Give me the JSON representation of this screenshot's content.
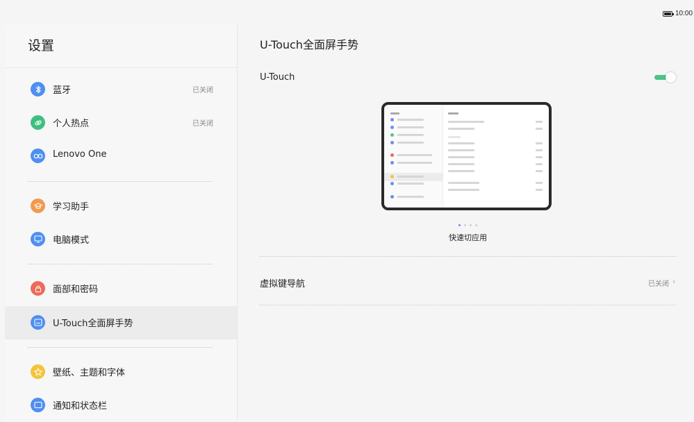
{
  "status_bar": {
    "time": "10:00",
    "battery_icon": "battery-full-icon"
  },
  "sidebar": {
    "title": "设置",
    "items": [
      {
        "label": "蓝牙",
        "status": "已关闭",
        "icon": "bluetooth-icon",
        "icon_color": "#4f8ff0"
      },
      {
        "label": "个人热点",
        "status": "已关闭",
        "icon": "link-icon",
        "icon_color": "#3fbf7f"
      },
      {
        "label": "Lenovo One",
        "status": "",
        "icon": "infinity-icon",
        "icon_color": "#4f8ff0"
      },
      {
        "label": "学习助手",
        "status": "",
        "icon": "graduation-cap-icon",
        "icon_color": "#f29a4c"
      },
      {
        "label": "电脑模式",
        "status": "",
        "icon": "monitor-icon",
        "icon_color": "#4f8ff0"
      },
      {
        "label": "面部和密码",
        "status": "",
        "icon": "lock-icon",
        "icon_color": "#ee6a5a"
      },
      {
        "label": "U-Touch全面屏手势",
        "status": "",
        "icon": "gesture-icon",
        "icon_color": "#4f8ff0",
        "selected": true
      },
      {
        "label": "壁纸、主题和字体",
        "status": "",
        "icon": "star-icon",
        "icon_color": "#f5c33b"
      },
      {
        "label": "通知和状态栏",
        "status": "",
        "icon": "notification-icon",
        "icon_color": "#4f8ff0"
      }
    ]
  },
  "main": {
    "title": "U-Touch全面屏手势",
    "utouch": {
      "label": "U-Touch",
      "enabled": true,
      "accent": "#4cc38a"
    },
    "carousel": {
      "caption": "快速切应用",
      "page_count": 4,
      "active_page": 1
    },
    "virtual_nav": {
      "label": "虚拟键导航",
      "status": "已关闭"
    }
  }
}
